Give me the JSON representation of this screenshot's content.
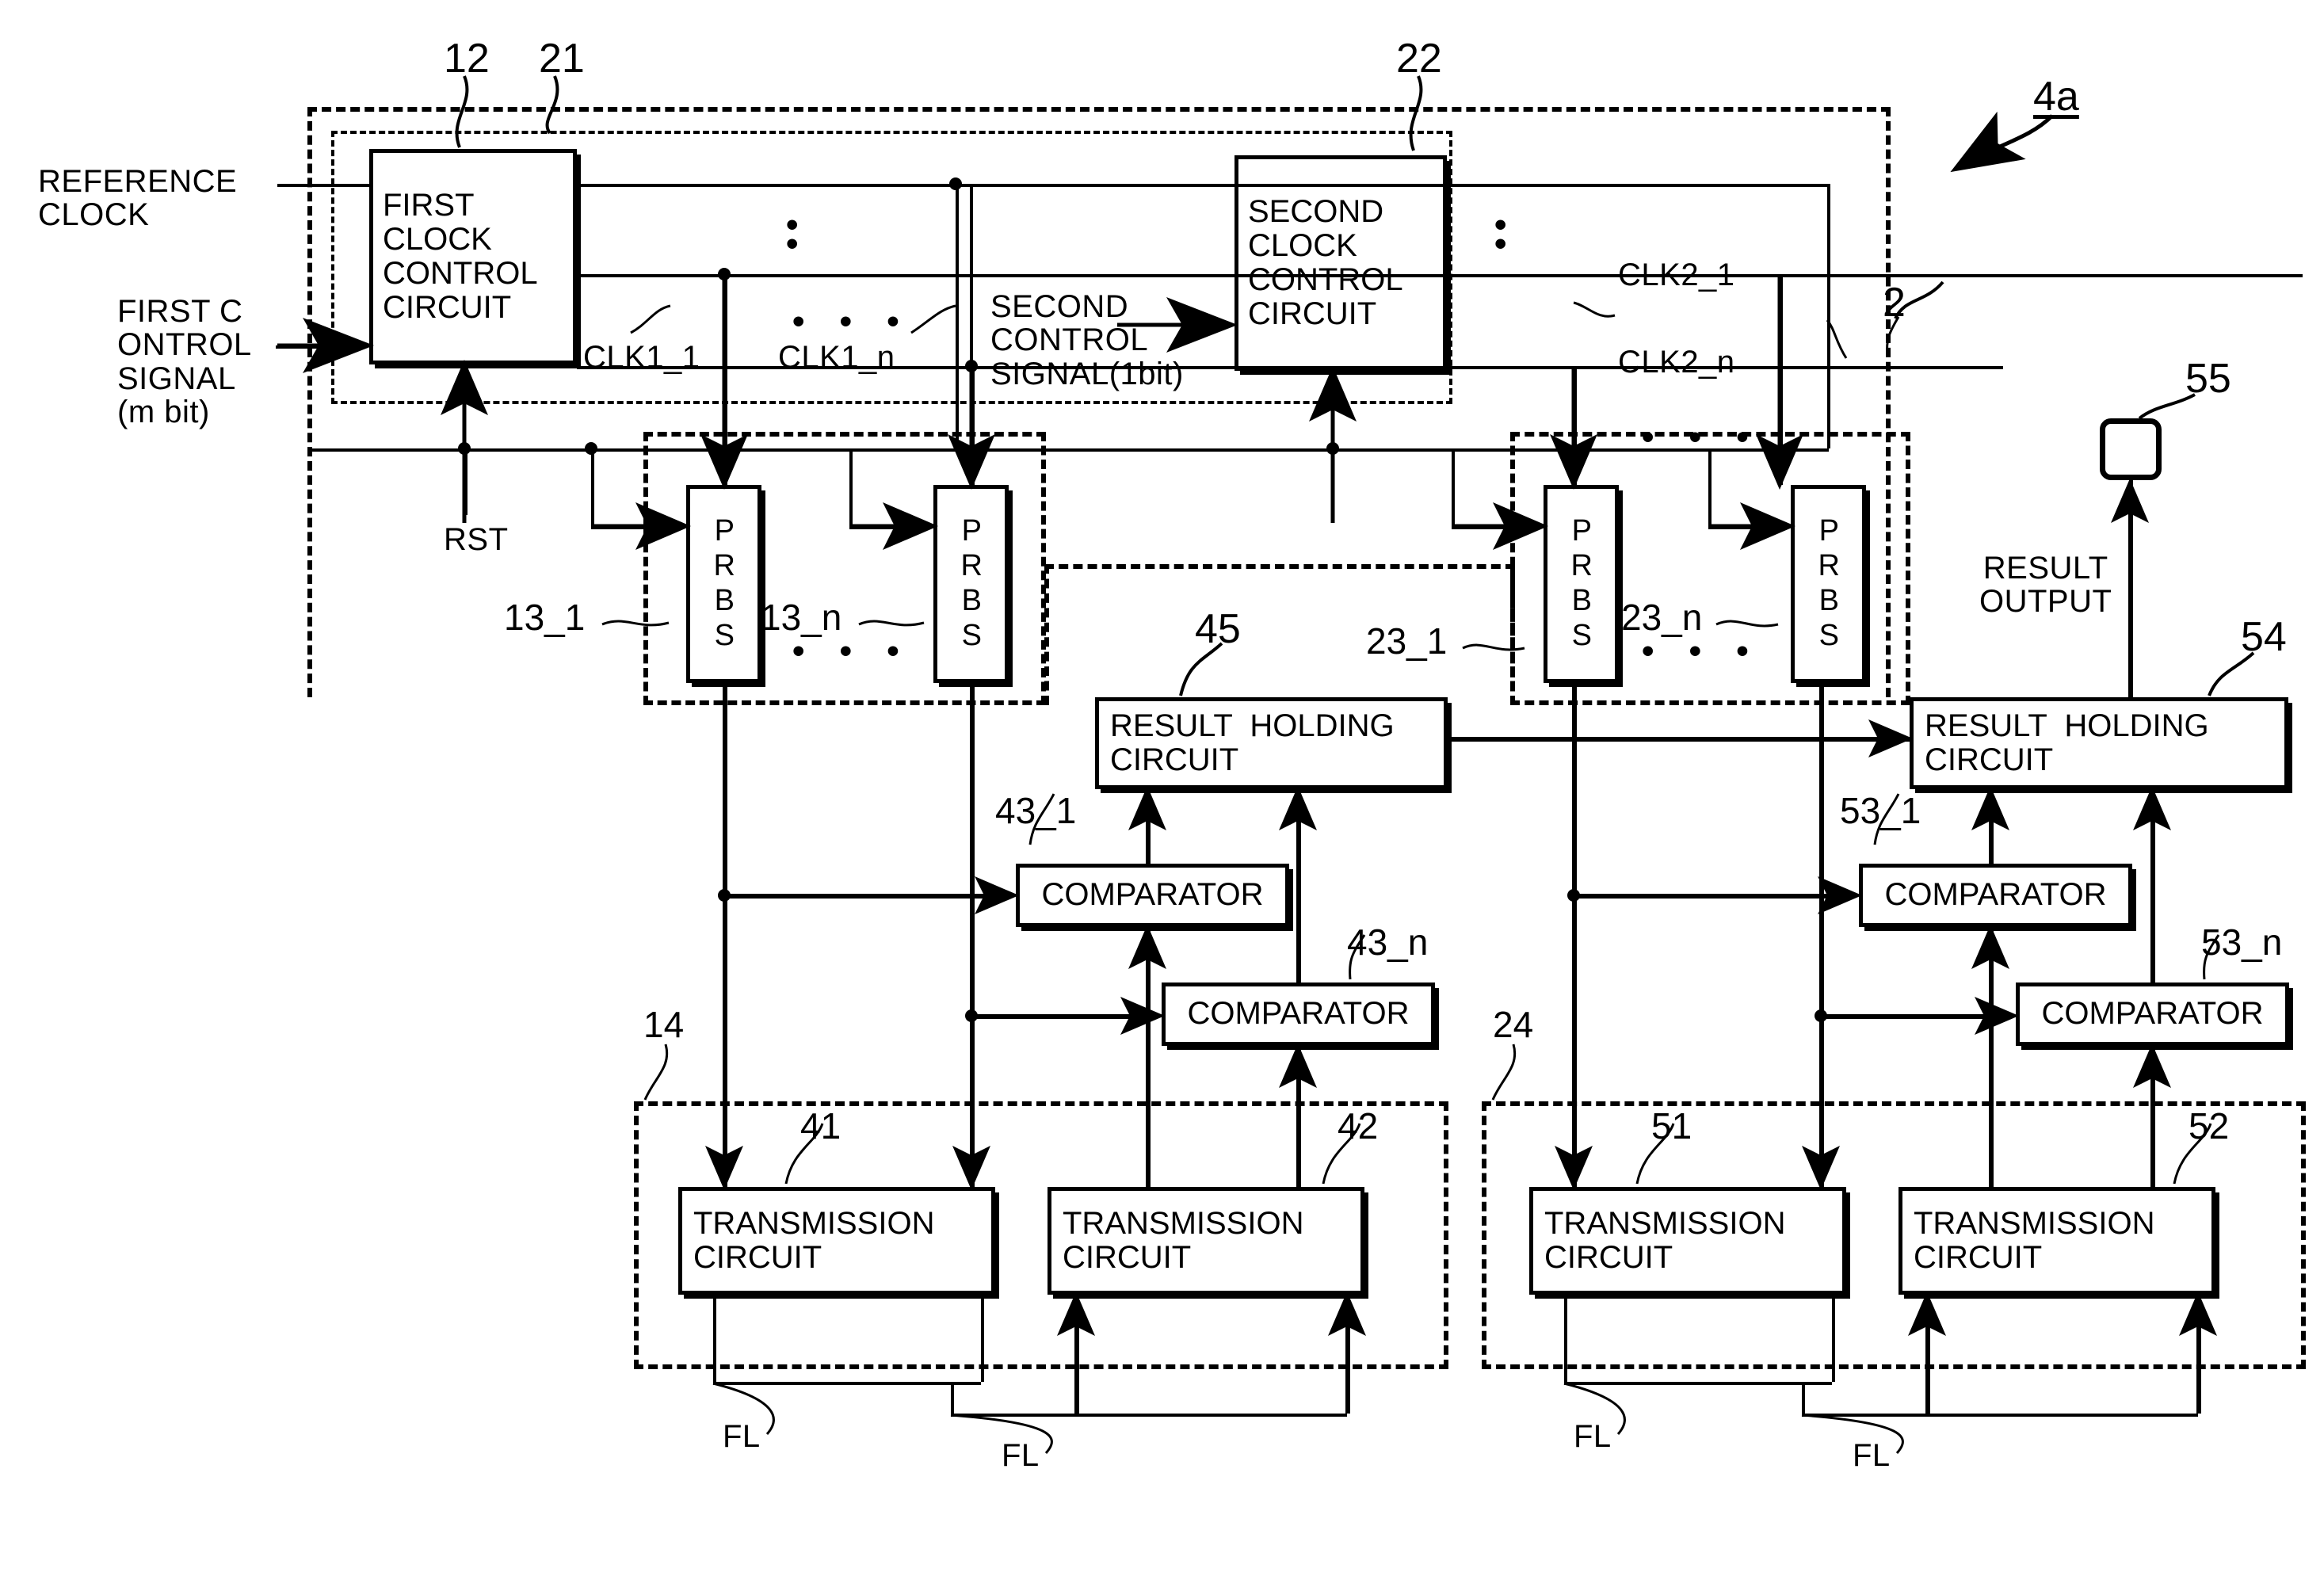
{
  "figure": {
    "type": "patent-block-diagram",
    "signals": {
      "reference_clock": "REFERENCE\nCLOCK",
      "first_control_signal": "FIRST C\nONTROL\nSIGNAL\n(m bit)",
      "second_control_signal": "SECOND\nCONTROL\nSIGNAL(1bit)",
      "rst": "RST",
      "result_output": "RESULT\nOUTPUT"
    },
    "clock_labels": {
      "clk1_1": "CLK1_1",
      "clk1_n": "CLK1_n",
      "clk2_1": "CLK2_1",
      "clk2_n": "CLK2_n"
    },
    "blocks": {
      "first_clock_control": "FIRST\nCLOCK\nCONTROL\nCIRCUIT",
      "second_clock_control": "SECOND\nCLOCK\nCONTROL\nCIRCUIT",
      "prbs": "PRBS",
      "comparator": "COMPARATOR",
      "result_holding": "RESULT  HOLDING\nCIRCUIT",
      "transmission": "TRANSMISSION\nCIRCUIT"
    },
    "reference_numerals": {
      "r12": "12",
      "r21": "21",
      "r22": "22",
      "r4a": "4a",
      "r2": "2",
      "r55": "55",
      "r54": "54",
      "r45": "45",
      "r13_1": "13_1",
      "r13_n": "13_n",
      "r23_1": "23_1",
      "r23_n": "23_n",
      "r43_1": "43_1",
      "r43_n": "43_n",
      "r53_1": "53_1",
      "r53_n": "53_n",
      "r14": "14",
      "r24": "24",
      "r41": "41",
      "r42": "42",
      "r51": "51",
      "r52": "52"
    },
    "loop_labels": {
      "fl1": "FL",
      "fl2": "FL",
      "fl3": "FL",
      "fl4": "FL"
    },
    "ellipsis": {
      "vertical": "•\n•",
      "horizontal": "• • •"
    },
    "colors": {
      "ink": "#000000",
      "paper": "#ffffff"
    }
  }
}
